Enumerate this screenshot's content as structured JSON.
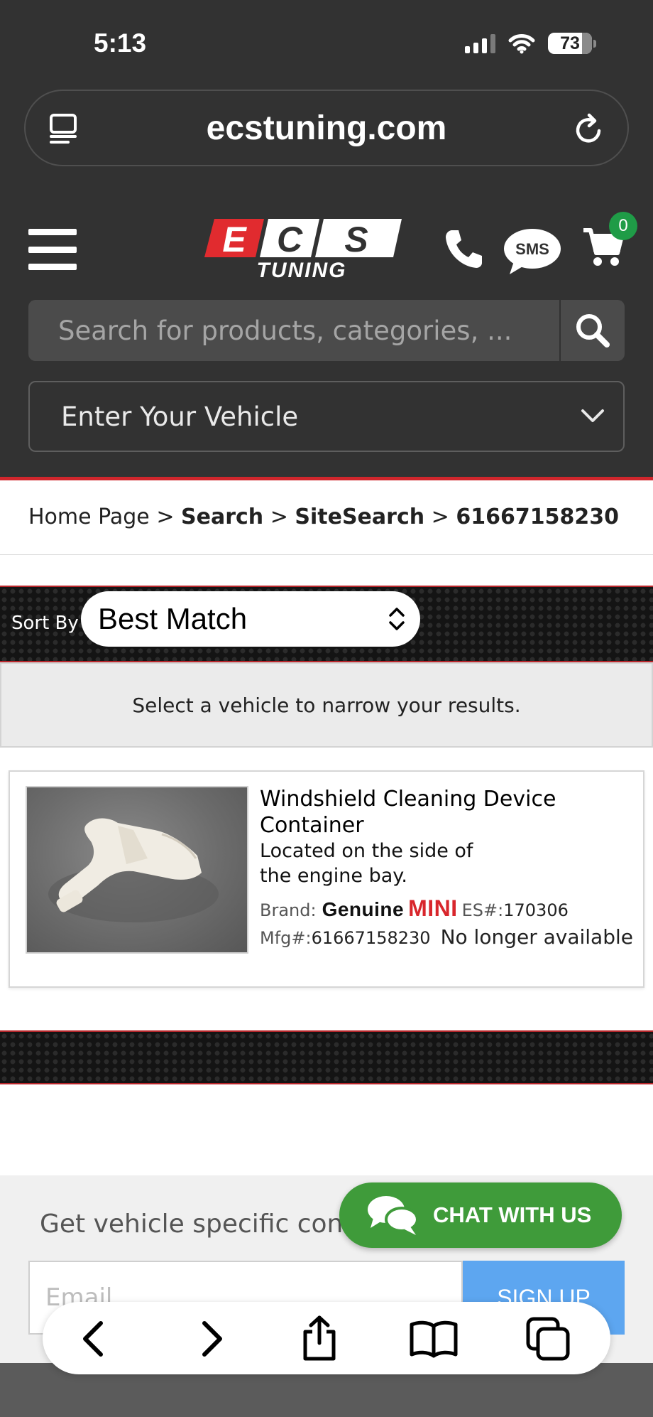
{
  "status_bar": {
    "time": "5:13",
    "battery": "73"
  },
  "browser": {
    "url": "ecstuning.com"
  },
  "header": {
    "logo_text": "ECS TUNING",
    "sms_label": "SMS",
    "cart_count": "0",
    "search_placeholder": "Search for products, categories, ...",
    "vehicle_select": "Enter Your Vehicle"
  },
  "breadcrumb": {
    "items": [
      "Home Page",
      "Search",
      "SiteSearch",
      "61667158230"
    ],
    "separator": ">"
  },
  "sort": {
    "label": "Sort By",
    "value": "Best Match"
  },
  "notice": "Select a vehicle to narrow your results.",
  "product": {
    "title": "Windshield Cleaning Device Container",
    "description": "Located on the side of the engine bay.",
    "brand_label": "Brand:",
    "brand_genuine": "Genuine",
    "brand_name": "MINI",
    "es_label": "ES#:",
    "es_value": "170306",
    "mfg_label": "Mfg#:",
    "mfg_value": "61667158230",
    "availability": "No longer available"
  },
  "newsletter": {
    "title": "Get vehicle specific cont",
    "email_placeholder": "Email",
    "button": "SIGN UP"
  },
  "chat": {
    "label": "CHAT WITH US"
  },
  "colors": {
    "header_bg": "#323232",
    "accent_red": "#d0262c",
    "cart_badge": "#1f9c47",
    "chat_green": "#3f9b3a",
    "signup_blue": "#5da6f0"
  }
}
